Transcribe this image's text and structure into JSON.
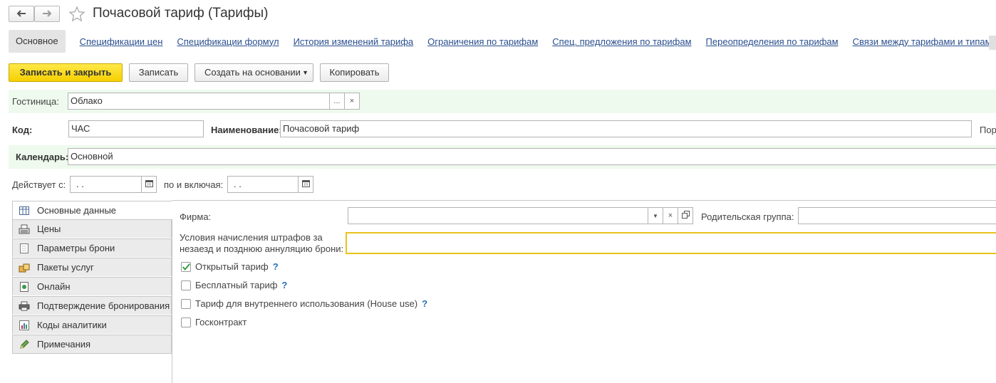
{
  "header": {
    "title": "Почасовой тариф (Тарифы)",
    "back_icon": "arrow-left-icon",
    "forward_icon": "arrow-right-icon",
    "favorite_icon": "star-icon"
  },
  "tabs": {
    "main": "Основное",
    "links": [
      "Спецификации цен",
      "Спецификации формул",
      "История изменений тарифа",
      "Ограничения по тарифам",
      "Спец. предложения по тарифам",
      "Переопределения по тарифам",
      "Связи между тарифами и типами карт"
    ]
  },
  "toolbar": {
    "save_close": "Записать и закрыть",
    "save": "Записать",
    "create_based": "Создать на основании",
    "copy": "Копировать"
  },
  "form": {
    "hotel_label": "Гостиница:",
    "hotel_value": "Облако",
    "code_label": "Код:",
    "code_value": "ЧАС",
    "name_label": "Наименование:",
    "name_value": "Почасовой тариф",
    "order_label_partial": "Пор",
    "calendar_label": "Календарь:",
    "calendar_value": "Основной",
    "valid_from_label": "Действует с:",
    "valid_from_value": "  .  .",
    "valid_to_label": "по и включая:",
    "valid_to_value": "  .  ."
  },
  "side_tabs": [
    {
      "label": "Основные данные",
      "icon": "table-icon"
    },
    {
      "label": "Цены",
      "icon": "cash-register-icon"
    },
    {
      "label": "Параметры брони",
      "icon": "document-icon"
    },
    {
      "label": "Пакеты услуг",
      "icon": "package-icon"
    },
    {
      "label": "Онлайн",
      "icon": "online-icon"
    },
    {
      "label": "Подтверждение бронирования",
      "icon": "printer-icon"
    },
    {
      "label": "Коды аналитики",
      "icon": "chart-icon"
    },
    {
      "label": "Примечания",
      "icon": "pencil-icon"
    }
  ],
  "details": {
    "firm_label": "Фирма:",
    "firm_value": "",
    "parent_group_label": "Родительская группа:",
    "parent_group_value": "",
    "penalty_label_line1": "Условия начисления штрафов за",
    "penalty_label_line2": "незаезд и позднюю аннуляцию брони:",
    "penalty_value": "",
    "help_mark": "?",
    "checkboxes": [
      {
        "label": "Открытый тариф",
        "checked": true,
        "help": true
      },
      {
        "label": "Бесплатный тариф",
        "checked": false,
        "help": true
      },
      {
        "label": "Тариф для внутреннего использования (House use)",
        "checked": false,
        "help": true
      },
      {
        "label": "Госконтракт",
        "checked": false,
        "help": false
      }
    ]
  },
  "colors": {
    "accent_yellow": "#f5cf00",
    "link": "#2a4f8f",
    "green_band": "#eefaee",
    "focus_border": "#e8c21a",
    "check_green": "#2e9a3a"
  }
}
